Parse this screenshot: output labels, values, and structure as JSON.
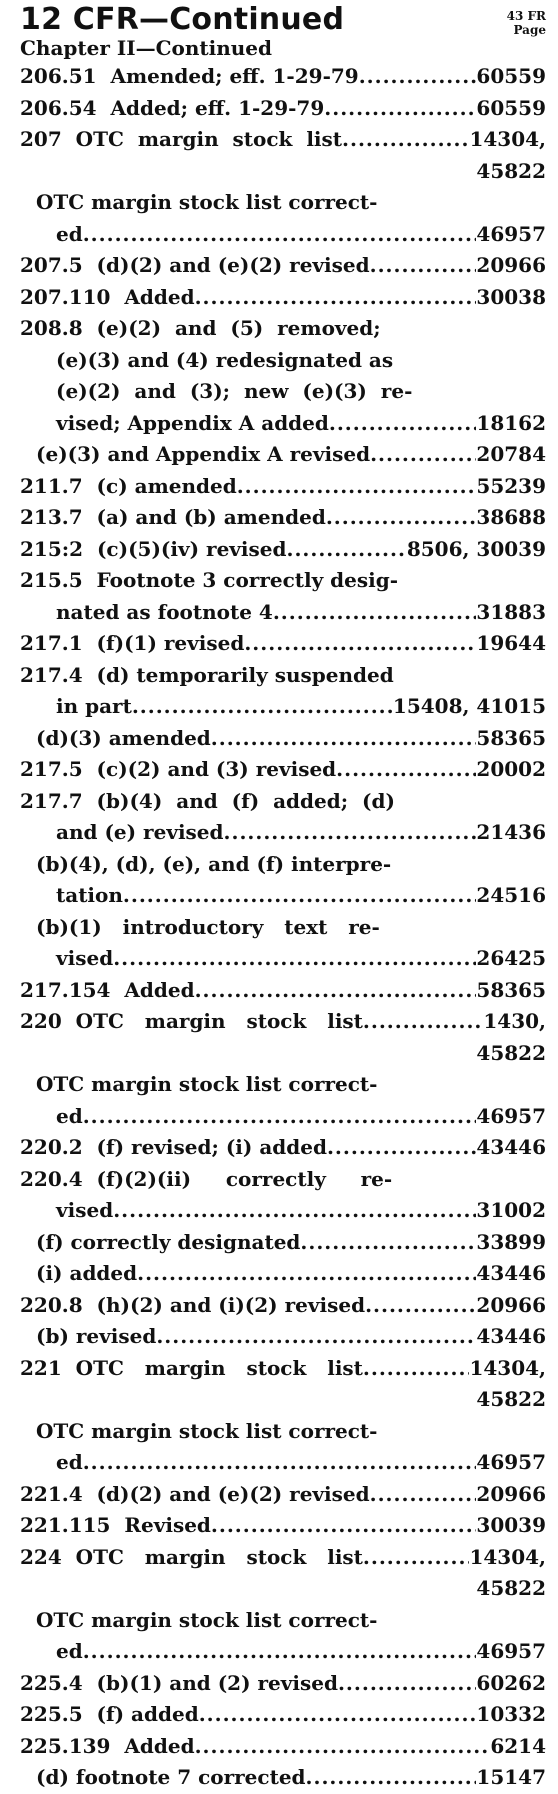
{
  "header": {
    "title": "12 CFR—Continued",
    "page_ref_lines": [
      "43 FR",
      "Page"
    ],
    "chapter": "Chapter II—Continued"
  },
  "lines": [
    {
      "indent": 0,
      "text": "206.51  Amended; eff. 1-29-79",
      "page": "60559"
    },
    {
      "indent": 0,
      "text": "206.54  Added; eff. 1-29-79",
      "page": "60559"
    },
    {
      "indent": 0,
      "text": "207  OTC  margin  stock  list",
      "page": "14304,"
    },
    {
      "indent": 0,
      "text": "",
      "page": "45822",
      "right": true
    },
    {
      "indent": 1,
      "text": "OTC margin stock list correct-",
      "page": ""
    },
    {
      "indent": 2,
      "text": "ed",
      "page": "46957"
    },
    {
      "indent": 0,
      "text": "207.5  (d)(2) and (e)(2) revised",
      "page": "20966"
    },
    {
      "indent": 0,
      "text": "207.110  Added",
      "page": "30038"
    },
    {
      "indent": 0,
      "text": "208.8  (e)(2)  and  (5)  removed;",
      "page": ""
    },
    {
      "indent": 2,
      "text": "(e)(3) and (4) redesignated as",
      "page": ""
    },
    {
      "indent": 2,
      "text": "(e)(2)  and  (3);  new  (e)(3)  re-",
      "page": ""
    },
    {
      "indent": 2,
      "text": "vised; Appendix A added",
      "page": "18162"
    },
    {
      "indent": 1,
      "text": "(e)(3) and Appendix A revised",
      "page": "20784"
    },
    {
      "indent": 0,
      "text": "211.7  (c) amended",
      "page": "55239"
    },
    {
      "indent": 0,
      "text": "213.7  (a) and (b) amended",
      "page": "38688"
    },
    {
      "indent": 0,
      "text": "215:2  (c)(5)(iv) revised",
      "page": "8506, 30039"
    },
    {
      "indent": 0,
      "text": "215.5  Footnote 3 correctly desig-",
      "page": ""
    },
    {
      "indent": 2,
      "text": "nated as footnote 4",
      "page": "31883"
    },
    {
      "indent": 0,
      "text": "217.1  (f)(1) revised",
      "page": "19644"
    },
    {
      "indent": 0,
      "text": "217.4  (d) temporarily suspended",
      "page": ""
    },
    {
      "indent": 2,
      "text": "in part",
      "page": "15408, 41015"
    },
    {
      "indent": 1,
      "text": "(d)(3) amended",
      "page": "58365"
    },
    {
      "indent": 0,
      "text": "217.5  (c)(2) and (3) revised",
      "page": "20002"
    },
    {
      "indent": 0,
      "text": "217.7  (b)(4)  and  (f)  added;  (d)",
      "page": ""
    },
    {
      "indent": 2,
      "text": "and (e) revised",
      "page": "21436"
    },
    {
      "indent": 1,
      "text": "(b)(4), (d), (e), and (f) interpre-",
      "page": ""
    },
    {
      "indent": 2,
      "text": "tation",
      "page": "24516"
    },
    {
      "indent": 1,
      "text": "(b)(1)   introductory   text   re-",
      "page": ""
    },
    {
      "indent": 2,
      "text": "vised",
      "page": "26425"
    },
    {
      "indent": 0,
      "text": "217.154  Added",
      "page": "58365"
    },
    {
      "indent": 0,
      "text": "220  OTC   margin   stock   list",
      "page": "1430,"
    },
    {
      "indent": 0,
      "text": "",
      "page": "45822",
      "right": true
    },
    {
      "indent": 1,
      "text": "OTC margin stock list correct-",
      "page": ""
    },
    {
      "indent": 2,
      "text": "ed",
      "page": "46957"
    },
    {
      "indent": 0,
      "text": "220.2  (f) revised; (i) added",
      "page": "43446"
    },
    {
      "indent": 0,
      "text": "220.4  (f)(2)(ii)     correctly     re-",
      "page": ""
    },
    {
      "indent": 2,
      "text": "vised",
      "page": "31002"
    },
    {
      "indent": 1,
      "text": "(f) correctly designated",
      "page": "33899"
    },
    {
      "indent": 1,
      "text": "(i) added",
      "page": "43446"
    },
    {
      "indent": 0,
      "text": "220.8  (h)(2) and (i)(2) revised",
      "page": "20966"
    },
    {
      "indent": 1,
      "text": "(b) revised",
      "page": "43446"
    },
    {
      "indent": 0,
      "text": "221  OTC   margin   stock   list",
      "page": "14304,"
    },
    {
      "indent": 0,
      "text": "",
      "page": "45822",
      "right": true
    },
    {
      "indent": 1,
      "text": "OTC margin stock list correct-",
      "page": ""
    },
    {
      "indent": 2,
      "text": "ed",
      "page": "46957"
    },
    {
      "indent": 0,
      "text": "221.4  (d)(2) and (e)(2) revised",
      "page": "20966"
    },
    {
      "indent": 0,
      "text": "221.115  Revised",
      "page": "30039"
    },
    {
      "indent": 0,
      "text": "224  OTC   margin   stock   list",
      "page": "14304,"
    },
    {
      "indent": 0,
      "text": "",
      "page": "45822",
      "right": true
    },
    {
      "indent": 1,
      "text": "OTC margin stock list correct-",
      "page": ""
    },
    {
      "indent": 2,
      "text": "ed",
      "page": "46957"
    },
    {
      "indent": 0,
      "text": "225.4  (b)(1) and (2) revised",
      "page": "60262"
    },
    {
      "indent": 0,
      "text": "225.5  (f) added",
      "page": "10332"
    },
    {
      "indent": 0,
      "text": "225.139  Added",
      "page": "6214"
    },
    {
      "indent": 1,
      "text": "(d) footnote 7 corrected",
      "page": "15147"
    }
  ]
}
